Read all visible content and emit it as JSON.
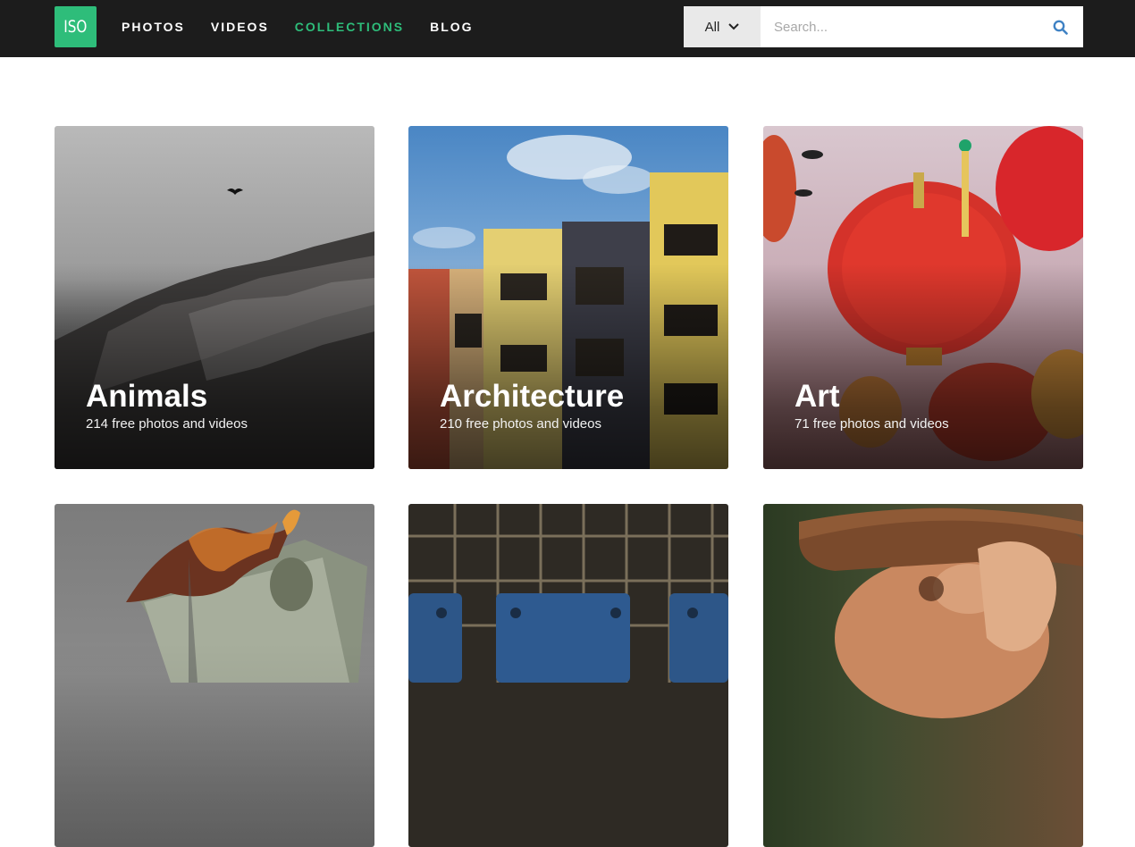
{
  "header": {
    "logo_text": "ISO",
    "nav": [
      {
        "label": "PHOTOS",
        "active": false
      },
      {
        "label": "VIDEOS",
        "active": false
      },
      {
        "label": "COLLECTIONS",
        "active": true
      },
      {
        "label": "BLOG",
        "active": false
      }
    ],
    "search": {
      "scope_value": "All",
      "placeholder": "Search...",
      "icon": "search-icon"
    }
  },
  "colors": {
    "brand": "#2ebd7a",
    "topbar": "#1c1c1c",
    "search_icon": "#3f82c4"
  },
  "collections": [
    {
      "title": "Animals",
      "subtitle": "214 free photos and videos"
    },
    {
      "title": "Architecture",
      "subtitle": "210 free photos and videos"
    },
    {
      "title": "Art",
      "subtitle": "71 free photos and videos"
    },
    {
      "title": "",
      "subtitle": ""
    },
    {
      "title": "",
      "subtitle": ""
    },
    {
      "title": "",
      "subtitle": ""
    }
  ]
}
